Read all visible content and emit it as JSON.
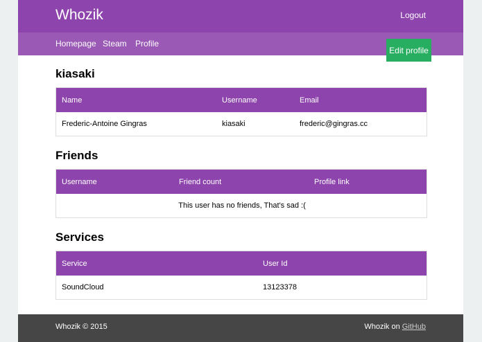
{
  "brand": "Whozik",
  "logout_label": "Logout",
  "nav": {
    "home": "Homepage",
    "steam": "Steam",
    "profile": "Profile",
    "edit_profile": "Edit profile"
  },
  "user_section": {
    "title": "kiasaki",
    "headers": [
      "Name",
      "Username",
      "Email"
    ],
    "row": [
      "Frederic-Antoine Gingras",
      "kiasaki",
      "frederic@gingras.cc"
    ]
  },
  "friends_section": {
    "title": "Friends",
    "headers": [
      "Username",
      "Friend count",
      "Profile link"
    ],
    "empty_message": "This user has no friends, That's sad :("
  },
  "services_section": {
    "title": "Services",
    "headers": [
      "Service",
      "User Id"
    ],
    "row": [
      "SoundCloud",
      "13123378"
    ]
  },
  "footer": {
    "copyright": "Whozik © 2015",
    "on_prefix": "Whozik on ",
    "github_link": "GitHub"
  },
  "colors": {
    "primary": "#8e44ad",
    "secondary": "#9b59b6",
    "success": "#27ae60",
    "footer": "#464646",
    "background": "#ecf0f1"
  }
}
